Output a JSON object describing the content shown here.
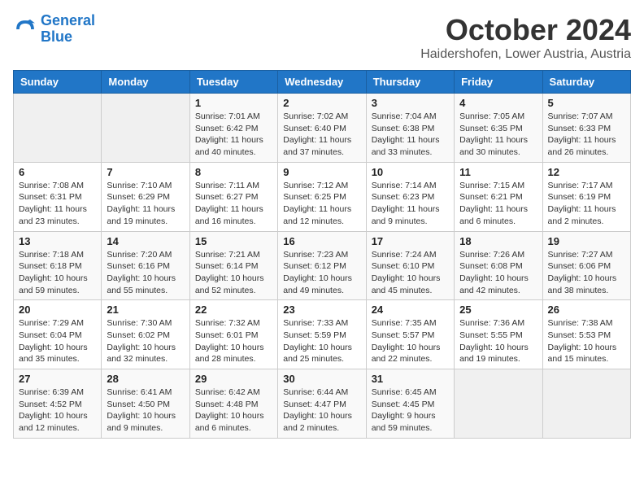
{
  "header": {
    "logo_line1": "General",
    "logo_line2": "Blue",
    "month": "October 2024",
    "location": "Haidershofen, Lower Austria, Austria"
  },
  "weekdays": [
    "Sunday",
    "Monday",
    "Tuesday",
    "Wednesday",
    "Thursday",
    "Friday",
    "Saturday"
  ],
  "weeks": [
    [
      {
        "day": "",
        "info": ""
      },
      {
        "day": "",
        "info": ""
      },
      {
        "day": "1",
        "info": "Sunrise: 7:01 AM\nSunset: 6:42 PM\nDaylight: 11 hours and 40 minutes."
      },
      {
        "day": "2",
        "info": "Sunrise: 7:02 AM\nSunset: 6:40 PM\nDaylight: 11 hours and 37 minutes."
      },
      {
        "day": "3",
        "info": "Sunrise: 7:04 AM\nSunset: 6:38 PM\nDaylight: 11 hours and 33 minutes."
      },
      {
        "day": "4",
        "info": "Sunrise: 7:05 AM\nSunset: 6:35 PM\nDaylight: 11 hours and 30 minutes."
      },
      {
        "day": "5",
        "info": "Sunrise: 7:07 AM\nSunset: 6:33 PM\nDaylight: 11 hours and 26 minutes."
      }
    ],
    [
      {
        "day": "6",
        "info": "Sunrise: 7:08 AM\nSunset: 6:31 PM\nDaylight: 11 hours and 23 minutes."
      },
      {
        "day": "7",
        "info": "Sunrise: 7:10 AM\nSunset: 6:29 PM\nDaylight: 11 hours and 19 minutes."
      },
      {
        "day": "8",
        "info": "Sunrise: 7:11 AM\nSunset: 6:27 PM\nDaylight: 11 hours and 16 minutes."
      },
      {
        "day": "9",
        "info": "Sunrise: 7:12 AM\nSunset: 6:25 PM\nDaylight: 11 hours and 12 minutes."
      },
      {
        "day": "10",
        "info": "Sunrise: 7:14 AM\nSunset: 6:23 PM\nDaylight: 11 hours and 9 minutes."
      },
      {
        "day": "11",
        "info": "Sunrise: 7:15 AM\nSunset: 6:21 PM\nDaylight: 11 hours and 6 minutes."
      },
      {
        "day": "12",
        "info": "Sunrise: 7:17 AM\nSunset: 6:19 PM\nDaylight: 11 hours and 2 minutes."
      }
    ],
    [
      {
        "day": "13",
        "info": "Sunrise: 7:18 AM\nSunset: 6:18 PM\nDaylight: 10 hours and 59 minutes."
      },
      {
        "day": "14",
        "info": "Sunrise: 7:20 AM\nSunset: 6:16 PM\nDaylight: 10 hours and 55 minutes."
      },
      {
        "day": "15",
        "info": "Sunrise: 7:21 AM\nSunset: 6:14 PM\nDaylight: 10 hours and 52 minutes."
      },
      {
        "day": "16",
        "info": "Sunrise: 7:23 AM\nSunset: 6:12 PM\nDaylight: 10 hours and 49 minutes."
      },
      {
        "day": "17",
        "info": "Sunrise: 7:24 AM\nSunset: 6:10 PM\nDaylight: 10 hours and 45 minutes."
      },
      {
        "day": "18",
        "info": "Sunrise: 7:26 AM\nSunset: 6:08 PM\nDaylight: 10 hours and 42 minutes."
      },
      {
        "day": "19",
        "info": "Sunrise: 7:27 AM\nSunset: 6:06 PM\nDaylight: 10 hours and 38 minutes."
      }
    ],
    [
      {
        "day": "20",
        "info": "Sunrise: 7:29 AM\nSunset: 6:04 PM\nDaylight: 10 hours and 35 minutes."
      },
      {
        "day": "21",
        "info": "Sunrise: 7:30 AM\nSunset: 6:02 PM\nDaylight: 10 hours and 32 minutes."
      },
      {
        "day": "22",
        "info": "Sunrise: 7:32 AM\nSunset: 6:01 PM\nDaylight: 10 hours and 28 minutes."
      },
      {
        "day": "23",
        "info": "Sunrise: 7:33 AM\nSunset: 5:59 PM\nDaylight: 10 hours and 25 minutes."
      },
      {
        "day": "24",
        "info": "Sunrise: 7:35 AM\nSunset: 5:57 PM\nDaylight: 10 hours and 22 minutes."
      },
      {
        "day": "25",
        "info": "Sunrise: 7:36 AM\nSunset: 5:55 PM\nDaylight: 10 hours and 19 minutes."
      },
      {
        "day": "26",
        "info": "Sunrise: 7:38 AM\nSunset: 5:53 PM\nDaylight: 10 hours and 15 minutes."
      }
    ],
    [
      {
        "day": "27",
        "info": "Sunrise: 6:39 AM\nSunset: 4:52 PM\nDaylight: 10 hours and 12 minutes."
      },
      {
        "day": "28",
        "info": "Sunrise: 6:41 AM\nSunset: 4:50 PM\nDaylight: 10 hours and 9 minutes."
      },
      {
        "day": "29",
        "info": "Sunrise: 6:42 AM\nSunset: 4:48 PM\nDaylight: 10 hours and 6 minutes."
      },
      {
        "day": "30",
        "info": "Sunrise: 6:44 AM\nSunset: 4:47 PM\nDaylight: 10 hours and 2 minutes."
      },
      {
        "day": "31",
        "info": "Sunrise: 6:45 AM\nSunset: 4:45 PM\nDaylight: 9 hours and 59 minutes."
      },
      {
        "day": "",
        "info": ""
      },
      {
        "day": "",
        "info": ""
      }
    ]
  ]
}
